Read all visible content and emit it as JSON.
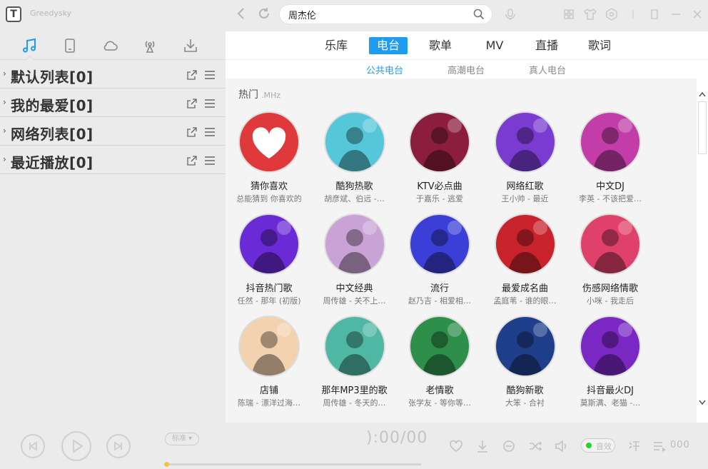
{
  "app": {
    "name": "Greedysky",
    "logo_letter": "T"
  },
  "search": {
    "value": "周杰伦"
  },
  "sidebar": {
    "tabs": [
      {
        "name": "music-note-icon",
        "active": true
      },
      {
        "name": "device-icon"
      },
      {
        "name": "cloud-icon"
      },
      {
        "name": "radio-icon"
      },
      {
        "name": "download-icon"
      }
    ],
    "playlists": [
      {
        "label": "默认列表[0]"
      },
      {
        "label": "我的最爱[0]"
      },
      {
        "label": "网络列表[0]"
      },
      {
        "label": "最近播放[0]"
      }
    ]
  },
  "main": {
    "tabs": [
      {
        "label": "乐库"
      },
      {
        "label": "电台",
        "active": true
      },
      {
        "label": "歌单"
      },
      {
        "label": "MV"
      },
      {
        "label": "直播"
      },
      {
        "label": "歌词"
      }
    ],
    "subtabs": [
      {
        "label": "公共电台",
        "active": true
      },
      {
        "label": "高潮电台"
      },
      {
        "label": "真人电台"
      }
    ],
    "section": {
      "title": "热门",
      "subtitle": ".MHz"
    },
    "stations": [
      {
        "title": "猜你喜欢",
        "sub": "总能猜到 你喜欢的",
        "bg": "#e0393b"
      },
      {
        "title": "酷狗热歌",
        "sub": "胡彦斌、伯远 -…",
        "bg": "#55c7d8"
      },
      {
        "title": "KTV必点曲",
        "sub": "于嘉乐 - 逃爱",
        "bg": "#8a1e3c"
      },
      {
        "title": "网络红歌",
        "sub": "王小帅 - 最近",
        "bg": "#7a3bd0"
      },
      {
        "title": "中文DJ",
        "sub": "李英 - 不该把爱…",
        "bg": "#c23da8"
      },
      {
        "title": "抖音热门歌",
        "sub": "任然 - 那年 (初版)",
        "bg": "#6a2bd6"
      },
      {
        "title": "中文经典",
        "sub": "周传雄 - 关不上…",
        "bg": "#c9a3d6"
      },
      {
        "title": "流行",
        "sub": "赵乃吉 - 相爱相…",
        "bg": "#3b3fd8"
      },
      {
        "title": "最爱成名曲",
        "sub": "孟庭苇 - 谁的眼…",
        "bg": "#c8232c"
      },
      {
        "title": "伤感网络情歌",
        "sub": "小咪 - 我走后",
        "bg": "#e0416a"
      },
      {
        "title": "店铺",
        "sub": "陈瑞 - 漂洋过海…",
        "bg": "#f3d2b0"
      },
      {
        "title": "那年MP3里的歌",
        "sub": "周传雄 - 冬天的…",
        "bg": "#4fb7a4"
      },
      {
        "title": "老情歌",
        "sub": "张学友 - 等你等…",
        "bg": "#2e8f4a"
      },
      {
        "title": "酷狗新歌",
        "sub": "大笨 - 合衬",
        "bg": "#1f3f8a"
      },
      {
        "title": "抖音最火DJ",
        "sub": "莫斯满、老猫 -…",
        "bg": "#7a27c4"
      }
    ]
  },
  "player": {
    "quality": "标准",
    "time": "):00/00",
    "progress": 0.0,
    "sound_label": "音效",
    "count": "000"
  }
}
